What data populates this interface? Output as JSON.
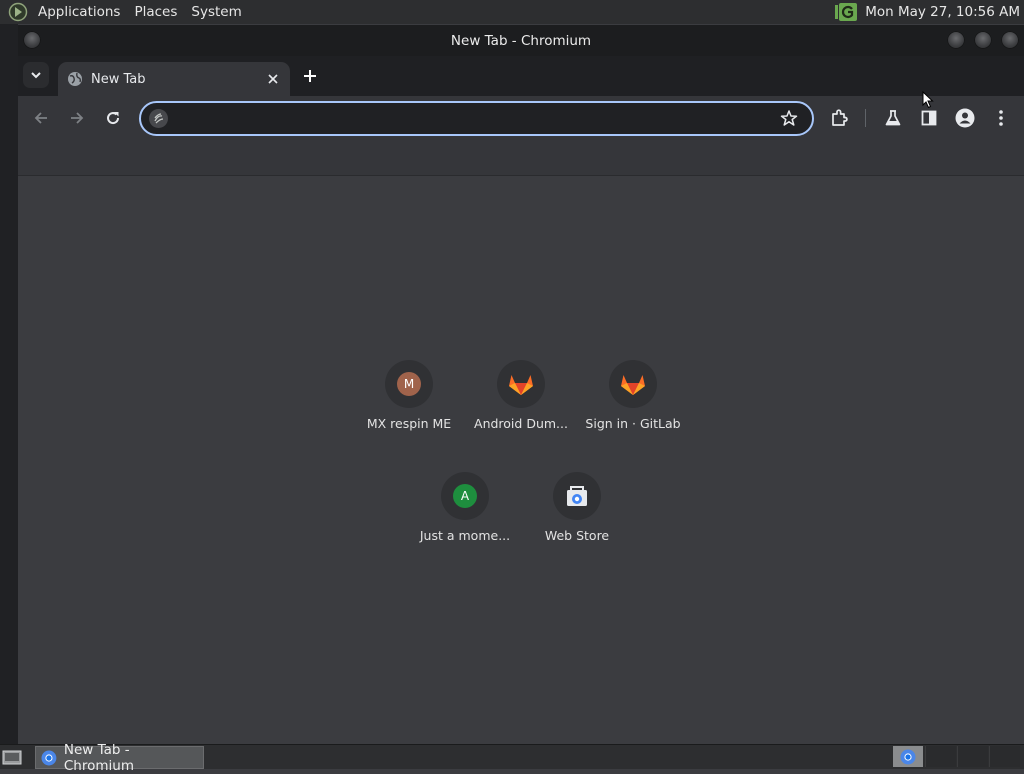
{
  "top_panel": {
    "menus": [
      "Applications",
      "Places",
      "System"
    ],
    "clock": "Mon May 27, 10:56 AM",
    "tray_icon": "gpg-indicator-icon"
  },
  "window": {
    "title": "New Tab - Chromium"
  },
  "tab": {
    "title": "New Tab"
  },
  "toolbar": {
    "omnibox_value": ""
  },
  "shortcuts": [
    {
      "label": "MX respin ME",
      "icon": "letter",
      "letter": "M",
      "color": "#a0634b"
    },
    {
      "label": "Android Dum...",
      "icon": "gitlab-icon"
    },
    {
      "label": "Sign in · GitLab",
      "icon": "gitlab-icon"
    },
    {
      "label": "Just a mome...",
      "icon": "letter",
      "letter": "A",
      "color": "#1e8e3e"
    },
    {
      "label": "Web Store",
      "icon": "web-store-icon"
    }
  ],
  "taskbar": {
    "task_label": "New Tab - Chromium"
  },
  "colors": {
    "accent_focus": "#a8c7fa",
    "panel_bg": "#2d2e30",
    "tab_active_bg": "#35363a"
  }
}
